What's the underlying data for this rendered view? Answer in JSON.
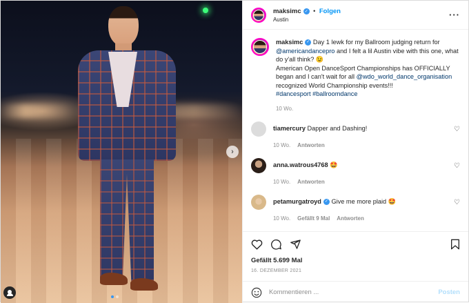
{
  "post": {
    "username": "maksimc",
    "verified": true,
    "follow_label": "Folgen",
    "location": "Austin",
    "more_icon": "more-icon",
    "photo": {
      "carousel_next_icon": "chevron-right-icon",
      "dots": 2,
      "active_dot": 0,
      "tag_icon": "user-tag-icon"
    },
    "caption": {
      "username": "maksimc",
      "part1": "Day 1 lewk for my Ballroom judging return for ",
      "mention1": "@americandancepro",
      "part2": " and I felt a lil Austin vibe with this one, what do y'all think? 😉",
      "part3": "American Open DanceSport Championships has OFFICIALLY began and I can't wait for all ",
      "mention2": "@wdo_world_dance_organisation",
      "part4": " recognized World Championship events!!!",
      "hashtags": "#dancesport #ballroomdance",
      "time": "10 Wo."
    },
    "comments": [
      {
        "username": "tiamercury",
        "text": "Dapper and Dashing!",
        "time": "10 Wo.",
        "likes_text": "",
        "reply_label": "Antworten"
      },
      {
        "username": "anna.watrous4768",
        "text": "🤩",
        "time": "10 Wo.",
        "likes_text": "",
        "reply_label": "Antworten"
      },
      {
        "username": "petamurgatroyd",
        "verified": true,
        "text": "Give me more plaid 🤩",
        "time": "10 Wo.",
        "likes_text": "Gefällt 9 Mal",
        "reply_label": "Antworten"
      }
    ],
    "likes": "Gefällt 5.699 Mal",
    "date": "16. DEZEMBER 2021",
    "add_comment_placeholder": "Kommentieren ...",
    "post_button": "Posten"
  },
  "colors": {
    "accent": "#0095f6",
    "verified": "#3897f0",
    "muted": "#8e8e8e",
    "post_button_disabled": "#b2dffc"
  }
}
